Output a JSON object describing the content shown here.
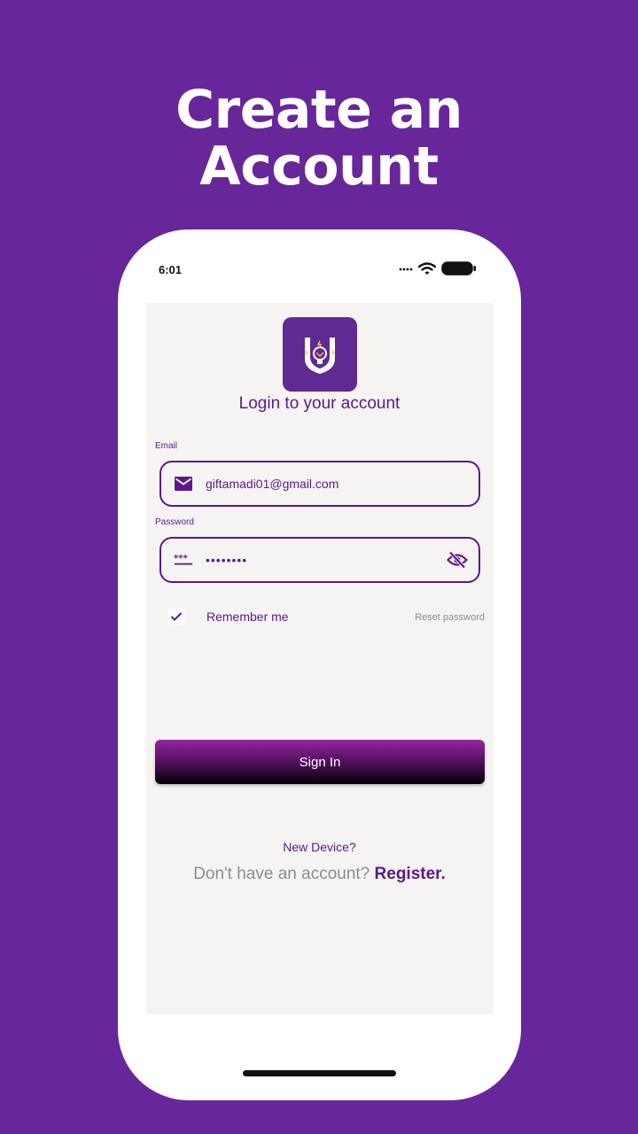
{
  "promo": {
    "headline_line1": "Create an",
    "headline_line2": "Account"
  },
  "status_bar": {
    "time": "6:01"
  },
  "login": {
    "title": "Login to your account",
    "email_label": "Email",
    "email_value": "giftamadi01@gmail.com",
    "password_label": "Password",
    "password_value": "••••••••",
    "remember_label": "Remember me",
    "remember_checked": true,
    "reset_label": "Reset password",
    "signin_label": "Sign In",
    "new_device_label": "New Device?",
    "no_account_text": "Don't have an account?",
    "register_label": "Register."
  },
  "colors": {
    "background": "#68269b",
    "accent": "#5b1a89",
    "screen_bg": "#f6f3f3",
    "muted_text": "#8c8c8c"
  },
  "icons": {
    "email": "mail-icon",
    "password": "password-dots-icon",
    "visibility": "eye-off-icon",
    "check": "check-icon",
    "logo": "lightbulb-shield-icon"
  }
}
